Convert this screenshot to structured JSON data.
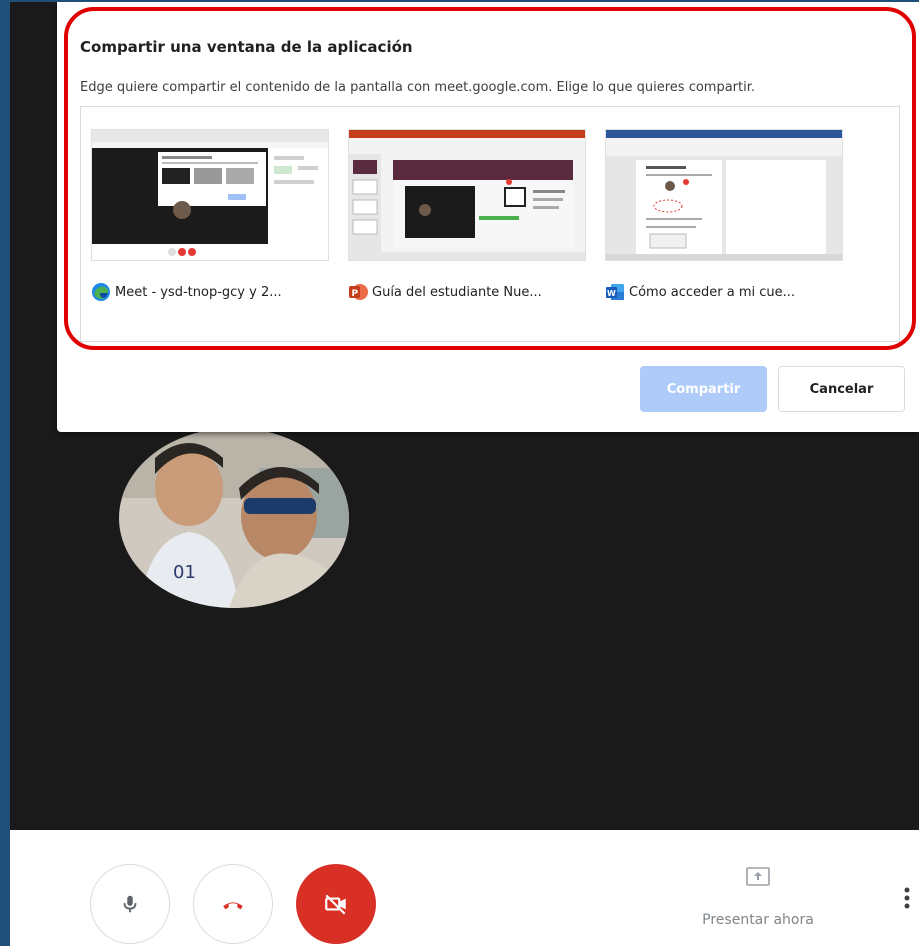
{
  "dialog": {
    "title": "Compartir una ventana de la aplicación",
    "description": "Edge quiere compartir el contenido de la pantalla con meet.google.com. Elige lo que quieres compartir.",
    "windows": [
      {
        "label": "Meet - ysd-tnop-gcy y 2...",
        "app_icon": "edge-icon"
      },
      {
        "label": "Guía del estudiante Nue...",
        "app_icon": "powerpoint-icon"
      },
      {
        "label": "Cómo acceder a mi cue...",
        "app_icon": "word-icon"
      }
    ],
    "share_button": "Compartir",
    "cancel_button": "Cancelar"
  },
  "toolbar": {
    "present_label": "Presentar ahora",
    "icons": [
      "microphone-icon",
      "hang-up-icon",
      "camera-off-icon",
      "present-screen-icon",
      "more-vertical-icon"
    ]
  },
  "colors": {
    "highlight": "#e00000",
    "share_button_disabled": "#aecbfa",
    "camera_off_red": "#d93025",
    "stage_background": "#1a1a1a",
    "outer_border": "#1f4e79"
  }
}
